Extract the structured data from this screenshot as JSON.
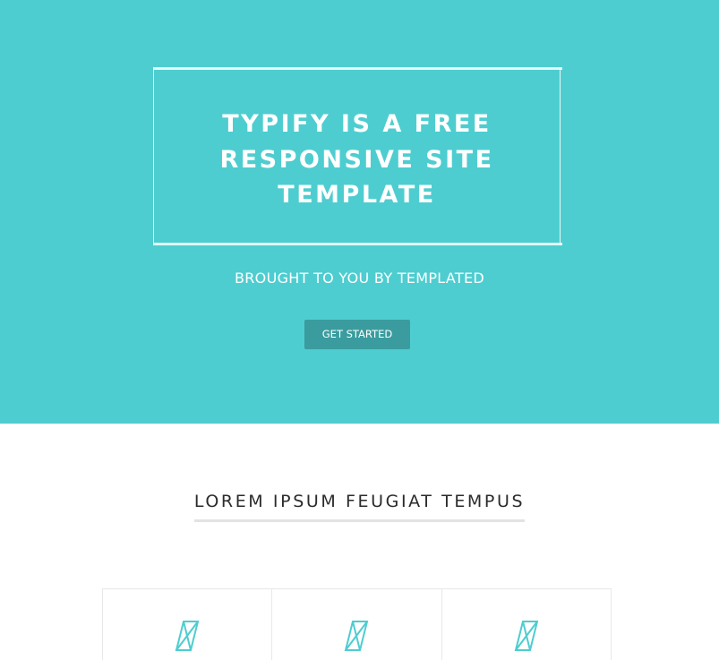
{
  "banner": {
    "title": "TYPIFY IS A FREE RESPONSIVE SITE TEMPLATE",
    "subtitle": "BROUGHT TO YOU BY TEMPLATED",
    "cta_label": "GET STARTED"
  },
  "section": {
    "title": "LOREM IPSUM FEUGIAT TEMPUS"
  },
  "features": [
    {
      "icon": "diamond-icon"
    },
    {
      "icon": "diamond-icon"
    },
    {
      "icon": "diamond-icon"
    }
  ],
  "colors": {
    "banner_bg": "#4ecdd0",
    "button_bg": "#3a9c9e",
    "accent_icon": "#4ecdd0",
    "text_dark": "#2b2b2b"
  }
}
